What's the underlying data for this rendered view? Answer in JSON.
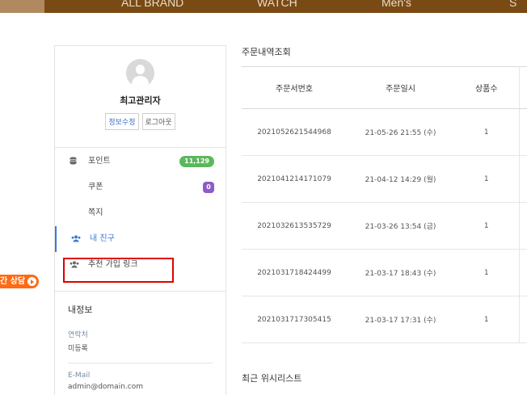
{
  "topnav": {
    "items": [
      "ALL BRAND",
      "WATCH",
      "Men's",
      "S"
    ]
  },
  "side_badge": {
    "label": "간 상담"
  },
  "profile": {
    "username": "최고관리자",
    "edit_label": "정보수정",
    "logout_label": "로그아웃"
  },
  "menu": {
    "items": [
      {
        "label": "포인트",
        "icon": "database-icon",
        "badge": "11,129",
        "badge_color": "#5bb85b"
      },
      {
        "label": "쿠폰",
        "badge": "0",
        "badge_color": "#8e5cc7"
      },
      {
        "label": "쪽지"
      },
      {
        "label": "내 친구",
        "icon": "users-icon",
        "active": true
      },
      {
        "label": "추천 가입 링크",
        "icon": "users-icon",
        "highlighted": true
      }
    ]
  },
  "info": {
    "title": "내정보",
    "contact_label": "연락처",
    "contact_value": "미등록",
    "email_label": "E-Mail",
    "email_value": "admin@domain.com"
  },
  "orders": {
    "title": "주문내역조회",
    "headers": [
      "주문서번호",
      "주문일시",
      "상품수"
    ],
    "rows": [
      {
        "id": "2021052621544968",
        "date": "21-05-26 21:55 (수)",
        "qty": "1"
      },
      {
        "id": "2021041214171079",
        "date": "21-04-12 14:29 (월)",
        "qty": "1"
      },
      {
        "id": "2021032613535729",
        "date": "21-03-26 13:54 (금)",
        "qty": "1"
      },
      {
        "id": "2021031718424499",
        "date": "21-03-17 18:43 (수)",
        "qty": "1"
      },
      {
        "id": "2021031717305415",
        "date": "21-03-17 17:31 (수)",
        "qty": "1"
      }
    ]
  },
  "wishlist": {
    "title": "최근 위시리스트"
  },
  "colors": {
    "accent": "#3a7bd5",
    "nav": "#7a4a14",
    "highlight": "#e00000",
    "badge_orange": "#ff6a13"
  }
}
